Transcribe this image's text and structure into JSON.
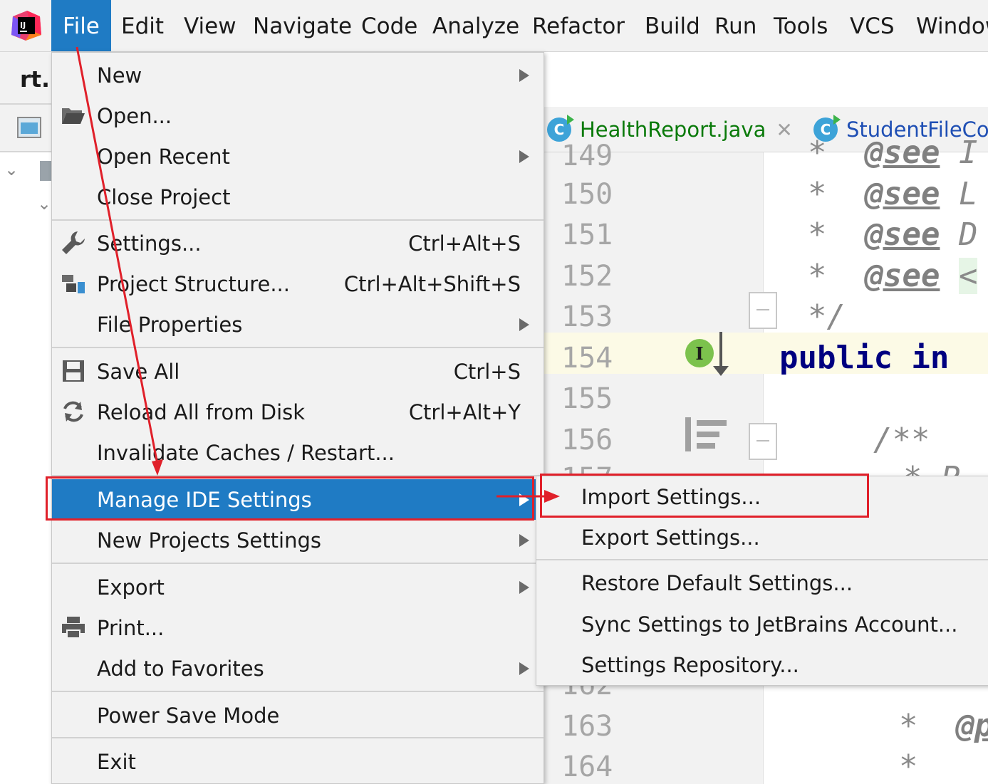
{
  "menubar": {
    "items": [
      {
        "label": "File",
        "active": true
      },
      {
        "label": "Edit"
      },
      {
        "label": "View"
      },
      {
        "label": "Navigate"
      },
      {
        "label": "Code"
      },
      {
        "label": "Analyze"
      },
      {
        "label": "Refactor"
      },
      {
        "label": "Build"
      },
      {
        "label": "Run"
      },
      {
        "label": "Tools"
      },
      {
        "label": "VCS"
      },
      {
        "label": "Window"
      }
    ]
  },
  "project_panel": {
    "tab_label": "rt."
  },
  "editor": {
    "tabs": [
      {
        "label": "HealthReport.java",
        "icon": "class-icon",
        "color": "#0a7a0a"
      },
      {
        "label": "StudentFileCon",
        "icon": "class-icon",
        "color": "#1f4fb4"
      }
    ],
    "line_numbers": [
      "149",
      "150",
      "151",
      "152",
      "153",
      "154",
      "155",
      "156",
      "157",
      "162",
      "163",
      "164"
    ],
    "code": {
      "l149": [
        "*",
        "@see",
        "I"
      ],
      "l150": [
        "*",
        "@see",
        "L"
      ],
      "l151": [
        "*",
        "@see",
        "D"
      ],
      "l152": [
        "*",
        "@see",
        "<"
      ],
      "l153": "*/",
      "l154": "public in",
      "l156": "/**",
      "l157": "* P",
      "l163": [
        "*",
        "@p"
      ],
      "l164": "*"
    },
    "impl_icon_letter": "I"
  },
  "file_menu": {
    "items": [
      {
        "label": "New",
        "submenu": true
      },
      {
        "label": "Open...",
        "icon": "folder-open-icon"
      },
      {
        "label": "Open Recent",
        "submenu": true
      },
      {
        "label": "Close Project"
      },
      {
        "label": "Settings...",
        "shortcut": "Ctrl+Alt+S",
        "icon": "wrench-icon"
      },
      {
        "label": "Project Structure...",
        "shortcut": "Ctrl+Alt+Shift+S",
        "icon": "project-structure-icon"
      },
      {
        "label": "File Properties",
        "submenu": true
      },
      {
        "label": "Save All",
        "shortcut": "Ctrl+S",
        "icon": "save-icon"
      },
      {
        "label": "Reload All from Disk",
        "shortcut": "Ctrl+Alt+Y",
        "icon": "reload-icon"
      },
      {
        "label": "Invalidate Caches / Restart..."
      },
      {
        "label": "Manage IDE Settings",
        "submenu": true,
        "selected": true
      },
      {
        "label": "New Projects Settings",
        "submenu": true
      },
      {
        "label": "Export",
        "submenu": true
      },
      {
        "label": "Print...",
        "icon": "printer-icon"
      },
      {
        "label": "Add to Favorites",
        "submenu": true
      },
      {
        "label": "Power Save Mode"
      },
      {
        "label": "Exit"
      }
    ]
  },
  "manage_ide_submenu": {
    "items": [
      {
        "label": "Import Settings..."
      },
      {
        "label": "Export Settings..."
      },
      {
        "label": "Restore Default Settings..."
      },
      {
        "label": "Sync Settings to JetBrains Account..."
      },
      {
        "label": "Settings Repository..."
      }
    ]
  },
  "colors": {
    "selection": "#1f7bc4",
    "annotation": "#e0202a",
    "menu_bg": "#f2f2f2"
  }
}
